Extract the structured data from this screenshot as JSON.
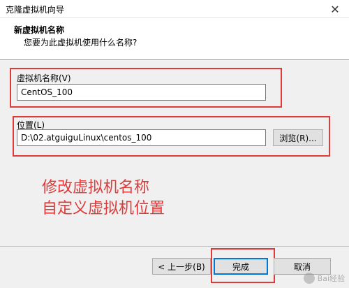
{
  "window": {
    "title": "克隆虚拟机向导",
    "close_glyph": "✕"
  },
  "header": {
    "title": "新虚拟机名称",
    "subtitle": "您要为此虚拟机使用什么名称?"
  },
  "vm_name": {
    "label": "虚拟机名称(V)",
    "value": "CentOS_100"
  },
  "location": {
    "label": "位置(L)",
    "value": "D:\\02.atguiguLinux\\centos_100",
    "browse_label": "浏览(R)..."
  },
  "annotation": {
    "line1": "修改虚拟机名称",
    "line2": "自定义虚拟机位置"
  },
  "footer": {
    "back_label": "< 上一步(B)",
    "finish_label": "完成",
    "cancel_label": "取消"
  },
  "watermark": {
    "text": "Bai经验"
  },
  "colors": {
    "annotation_red": "#e03a3a",
    "focus_blue": "#0078d7"
  }
}
